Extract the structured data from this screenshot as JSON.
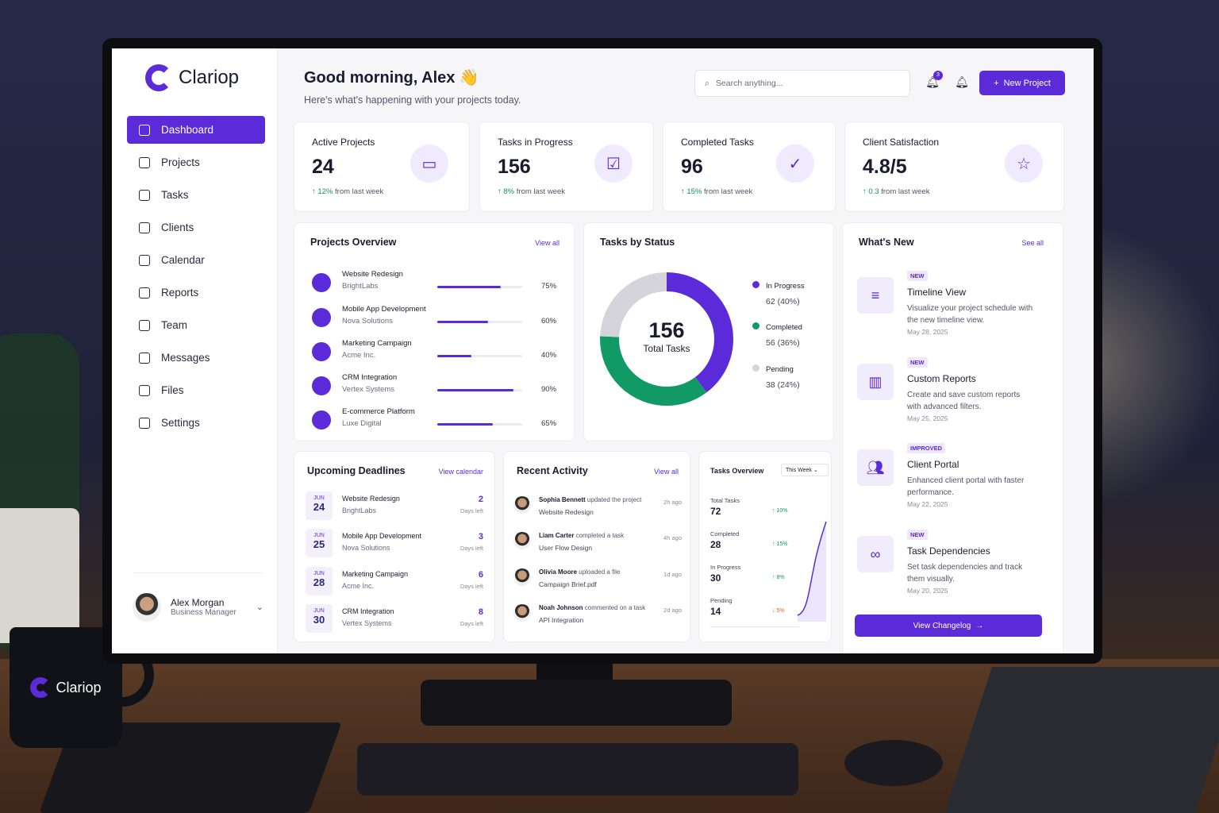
{
  "brand": {
    "name": "Clariop",
    "mug_text": "Clariop"
  },
  "nav": [
    {
      "label": "Dashboard",
      "icon": "dashboard-icon",
      "active": true
    },
    {
      "label": "Projects",
      "icon": "projects-icon"
    },
    {
      "label": "Tasks",
      "icon": "tasks-icon"
    },
    {
      "label": "Clients",
      "icon": "clients-icon"
    },
    {
      "label": "Calendar",
      "icon": "calendar-icon"
    },
    {
      "label": "Reports",
      "icon": "reports-icon"
    },
    {
      "label": "Team",
      "icon": "team-icon"
    },
    {
      "label": "Messages",
      "icon": "messages-icon"
    },
    {
      "label": "Files",
      "icon": "files-icon"
    },
    {
      "label": "Settings",
      "icon": "settings-icon"
    }
  ],
  "user": {
    "name": "Alex Morgan",
    "role": "Business Manager"
  },
  "header": {
    "greeting": "Good morning, Alex 👋",
    "subtitle": "Here's what's happening with your projects today.",
    "search_placeholder": "Search anything...",
    "notif_count": "3",
    "new_project": "New Project"
  },
  "stats": [
    {
      "title": "Active Projects",
      "value": "24",
      "trend": "12%",
      "trend_text": "from last week",
      "icon": "folder-icon"
    },
    {
      "title": "Tasks in Progress",
      "value": "156",
      "trend": "8%",
      "trend_text": "from last week",
      "icon": "clipboard-icon"
    },
    {
      "title": "Completed Tasks",
      "value": "96",
      "trend": "15%",
      "trend_text": "from last week",
      "icon": "check-circle-icon"
    },
    {
      "title": "Client Satisfaction",
      "value": "4.8/5",
      "trend": "0.3",
      "trend_text": "from last week",
      "icon": "star-icon"
    }
  ],
  "projects": {
    "title": "Projects Overview",
    "link": "View all",
    "items": [
      {
        "name": "Website Redesign",
        "client": "BrightLabs",
        "progress": 75,
        "pct": "75%"
      },
      {
        "name": "Mobile App Development",
        "client": "Nova Solutions",
        "progress": 60,
        "pct": "60%"
      },
      {
        "name": "Marketing Campaign",
        "client": "Acme Inc.",
        "progress": 40,
        "pct": "40%"
      },
      {
        "name": "CRM Integration",
        "client": "Vertex Systems",
        "progress": 90,
        "pct": "90%"
      },
      {
        "name": "E-commerce Platform",
        "client": "Luxe Digital",
        "progress": 65,
        "pct": "65%"
      }
    ]
  },
  "status": {
    "title": "Tasks by Status",
    "total": "156",
    "total_label": "Total Tasks",
    "legend": [
      {
        "label": "In Progress",
        "value": "62 (40%)",
        "color": "#5b2bd9"
      },
      {
        "label": "Completed",
        "value": "56 (36%)",
        "color": "#119a65"
      },
      {
        "label": "Pending",
        "value": "38 (24%)",
        "color": "#d4d4da"
      }
    ]
  },
  "chart_data": {
    "type": "pie",
    "categories": [
      "In Progress",
      "Completed",
      "Pending"
    ],
    "values": [
      62,
      56,
      38
    ],
    "title": "Tasks by Status"
  },
  "whatsnew": {
    "title": "What's New",
    "link": "See all",
    "items": [
      {
        "badge": "NEW",
        "title": "Timeline View",
        "desc": "Visualize your project schedule with the new timeline view.",
        "date": "May 28, 2025",
        "icon": "sliders-icon"
      },
      {
        "badge": "NEW",
        "title": "Custom Reports",
        "desc": "Create and save custom reports with advanced filters.",
        "date": "May 25, 2025",
        "icon": "bar-chart-icon"
      },
      {
        "badge": "IMPROVED",
        "title": "Client Portal",
        "desc": "Enhanced client portal with faster performance.",
        "date": "May 22, 2025",
        "icon": "users-icon"
      },
      {
        "badge": "NEW",
        "title": "Task Dependencies",
        "desc": "Set task dependencies and track them visually.",
        "date": "May 20, 2025",
        "icon": "link-icon"
      }
    ],
    "button": "View Changelog"
  },
  "deadlines": {
    "title": "Upcoming Deadlines",
    "link": "View calendar",
    "items": [
      {
        "month": "JUN",
        "day": "24",
        "name": "Website Redesign",
        "client": "BrightLabs",
        "days": "2",
        "days_label": "Days left"
      },
      {
        "month": "JUN",
        "day": "25",
        "name": "Mobile App Development",
        "client": "Nova Solutions",
        "days": "3",
        "days_label": "Days left"
      },
      {
        "month": "JUN",
        "day": "28",
        "name": "Marketing Campaign",
        "client": "Acme Inc.",
        "days": "6",
        "days_label": "Days left"
      },
      {
        "month": "JUN",
        "day": "30",
        "name": "CRM Integration",
        "client": "Vertex Systems",
        "days": "8",
        "days_label": "Days left"
      }
    ]
  },
  "activity": {
    "title": "Recent Activity",
    "link": "View all",
    "items": [
      {
        "user": "Sophia Bennett",
        "action": "updated the project",
        "target": "Website Redesign",
        "time": "2h ago"
      },
      {
        "user": "Liam Carter",
        "action": "completed a task",
        "target": "User Flow Design",
        "time": "4h ago"
      },
      {
        "user": "Olivia Moore",
        "action": "uploaded a file",
        "target": "Campaign Brief.pdf",
        "time": "1d ago"
      },
      {
        "user": "Noah Johnson",
        "action": "commented on a task",
        "target": "API Integration",
        "time": "2d ago"
      }
    ]
  },
  "tasks_overview": {
    "title": "Tasks Overview",
    "filter": "This Week",
    "rows": [
      {
        "label": "Total Tasks",
        "value": "72",
        "trend": "↑ 10%",
        "dir": "up"
      },
      {
        "label": "Completed",
        "value": "28",
        "trend": "↑ 15%",
        "dir": "up"
      },
      {
        "label": "In Progress",
        "value": "30",
        "trend": "↑ 8%",
        "dir": "up"
      },
      {
        "label": "Pending",
        "value": "14",
        "trend": "↓ 5%",
        "dir": "down"
      }
    ]
  }
}
